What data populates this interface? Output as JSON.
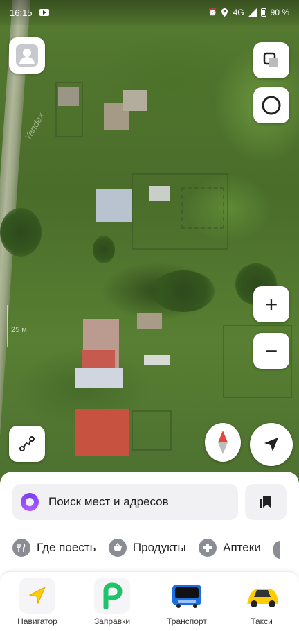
{
  "status_bar": {
    "time": "16:15",
    "network": "4G",
    "battery": "90 %"
  },
  "map": {
    "watermark": "Yandex",
    "scale_label": "25 м"
  },
  "map_controls": {
    "zoom_in_label": "+",
    "zoom_out_label": "−"
  },
  "search": {
    "placeholder": "Поиск мест и адресов"
  },
  "categories": [
    {
      "label": "Где поесть",
      "icon": "fork-knife-icon"
    },
    {
      "label": "Продукты",
      "icon": "basket-icon"
    },
    {
      "label": "Аптеки",
      "icon": "pharmacy-cross-icon"
    }
  ],
  "services": [
    {
      "label": "Навигатор",
      "icon": "navigator-arrow-icon"
    },
    {
      "label": "Заправки",
      "icon": "fuel-icon"
    },
    {
      "label": "Транспорт",
      "icon": "bus-icon"
    },
    {
      "label": "Такси",
      "icon": "taxi-car-icon"
    }
  ],
  "colors": {
    "accent_yellow": "#ffcc00",
    "alice_purple": "#8a45f5",
    "fuel_green": "#1fc46a",
    "bus_blue": "#1a6fe0"
  }
}
